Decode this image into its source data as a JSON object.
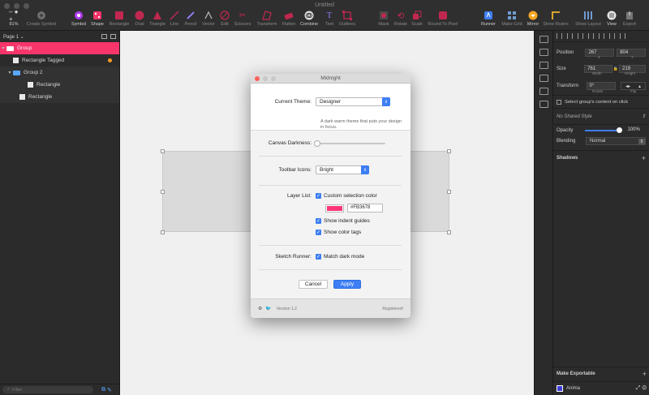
{
  "window": {
    "title": "Untitled"
  },
  "toolbar": {
    "zoom": "81%",
    "tools": [
      {
        "label": "Create Symbol",
        "icon": "create-symbol-icon"
      },
      {
        "label": "Symbol",
        "icon": "symbol-icon"
      },
      {
        "label": "Shape",
        "icon": "shape-icon"
      },
      {
        "label": "Rectangle",
        "icon": "rectangle-icon"
      },
      {
        "label": "Oval",
        "icon": "oval-icon"
      },
      {
        "label": "Triangle",
        "icon": "triangle-icon"
      },
      {
        "label": "Line",
        "icon": "line-icon"
      },
      {
        "label": "Pencil",
        "icon": "pencil-icon"
      },
      {
        "label": "Vector",
        "icon": "vector-icon"
      },
      {
        "label": "Edit",
        "icon": "edit-icon"
      },
      {
        "label": "Scissors",
        "icon": "scissors-icon"
      },
      {
        "label": "Transform",
        "icon": "transform-icon"
      },
      {
        "label": "Flatten",
        "icon": "flatten-icon"
      },
      {
        "label": "Combine",
        "icon": "combine-icon"
      },
      {
        "label": "Text",
        "icon": "text-icon"
      },
      {
        "label": "Outlines",
        "icon": "outlines-icon"
      },
      {
        "label": "Mask",
        "icon": "mask-icon"
      },
      {
        "label": "Rotate",
        "icon": "rotate-icon"
      },
      {
        "label": "Scale",
        "icon": "scale-icon"
      },
      {
        "label": "Round To Pixel",
        "icon": "round-to-pixel-icon"
      },
      {
        "label": "Runner",
        "icon": "runner-icon"
      },
      {
        "label": "Make Grid",
        "icon": "make-grid-icon"
      },
      {
        "label": "Mirror",
        "icon": "mirror-icon"
      },
      {
        "label": "Show Rulers",
        "icon": "rulers-icon"
      },
      {
        "label": "Show Layout",
        "icon": "layout-icon"
      },
      {
        "label": "View",
        "icon": "view-icon"
      },
      {
        "label": "Export",
        "icon": "export-icon"
      }
    ]
  },
  "layers": {
    "page": "Page 1",
    "items": [
      {
        "label": "Group",
        "type": "folder"
      },
      {
        "label": "Rectangle Tagged",
        "type": "shape"
      },
      {
        "label": "Group 2",
        "type": "folder"
      },
      {
        "label": "Rectangle",
        "type": "shape"
      },
      {
        "label": "Rectangle",
        "type": "shape"
      }
    ],
    "filter_placeholder": "Filter"
  },
  "dialog": {
    "title": "Midnight",
    "theme_label": "Current Theme:",
    "theme_value": "Designer",
    "theme_desc": "A dark warm theme that puts your design in focus.",
    "canvas_label": "Canvas Darkness:",
    "toolbar_label": "Toolbar Icons:",
    "toolbar_value": "Bright",
    "layer_label": "Layer List:",
    "custom_color": "Custom selection color",
    "hex": "#FB3678",
    "indent": "Show indent guides",
    "tags": "Show color tags",
    "runner_label": "Sketch Runner:",
    "runner_value": "Match dark mode",
    "cancel": "Cancel",
    "apply": "Apply",
    "version": "Version 1.2",
    "registered": "Registered!",
    "accent": "#FB3678"
  },
  "inspector": {
    "position_label": "Position",
    "x": "267",
    "y": "804",
    "x_sub": "X",
    "y_sub": "Y",
    "size_label": "Size",
    "w": "761",
    "h": "219",
    "w_sub": "Width",
    "h_sub": "Height",
    "transform_label": "Transform",
    "rotate": "0°",
    "rotate_sub": "Rotate",
    "flip_sub": "Flip",
    "select_group": "Select group's content on click",
    "shared_style": "No Shared Style",
    "opacity_label": "Opacity",
    "opacity": "100%",
    "blending_label": "Blending",
    "blending": "Normal",
    "shadows": "Shadows",
    "exportable": "Make Exportable",
    "anima": "Anima"
  }
}
